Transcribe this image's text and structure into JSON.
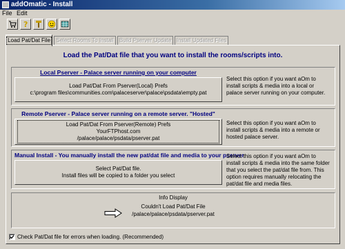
{
  "window": {
    "title": "addOmatic - Install"
  },
  "menu": [
    "File",
    "Edit"
  ],
  "toolbar": {
    "icons": [
      "cart-icon",
      "help-icon",
      "tools-icon",
      "smiley-icon",
      "grid-icon"
    ]
  },
  "tabs": [
    {
      "label": "Load Pat/Dat File",
      "active": true
    },
    {
      "label": "Select Rooms To Install",
      "active": false
    },
    {
      "label": "Build Pserver Update",
      "active": false
    },
    {
      "label": "Install Updated Files",
      "active": false
    }
  ],
  "main": {
    "heading": "Load the Pat/Dat file that you want to install the rooms/scripts into."
  },
  "options": {
    "local": {
      "title": "Local Pserver - Palace server running on your computer",
      "button_line1": "Load Pat/Dat From Pserver(Local) Prefs",
      "button_line2": "c:\\program files\\communities.com\\palaceserver\\palace\\psdata\\empty.pat",
      "description": "Select this option if you want aOm to install scripts & media into a local or palace server running on your computer."
    },
    "remote": {
      "title": "Remote Pserver - Palace server running on a remote server. \"Hosted\"",
      "button_line1": "Load Pat/Dat From Pserver(Remote) Prefs",
      "button_line2": "YourFTPhost.com",
      "button_line3": "/palace/palace/psdata/pserver.pat",
      "description": "Select this option if you want aOm to install scripts & media into a remote or hosted palace server."
    },
    "manual": {
      "title": "Manual Install - You manually install the new pat/dat file and media to your pserver",
      "button_line1": "Select Pat/Dat file.",
      "button_line2": "Install files will be copied to a folder you select",
      "description": "Select this option if you want aOm to install scripts & media into the same folder that you select the pat/dat file from. This option requires manually relocating the pat/dat file and media files."
    }
  },
  "info": {
    "title": "Info Display",
    "message": "Couldn't Load Pat/Dat File",
    "path": "/palace/palace/psdata/pserver.pat"
  },
  "checkbox": {
    "label": "Check Pat/Dat file for errors when loading. (Recommended)",
    "checked": true
  }
}
